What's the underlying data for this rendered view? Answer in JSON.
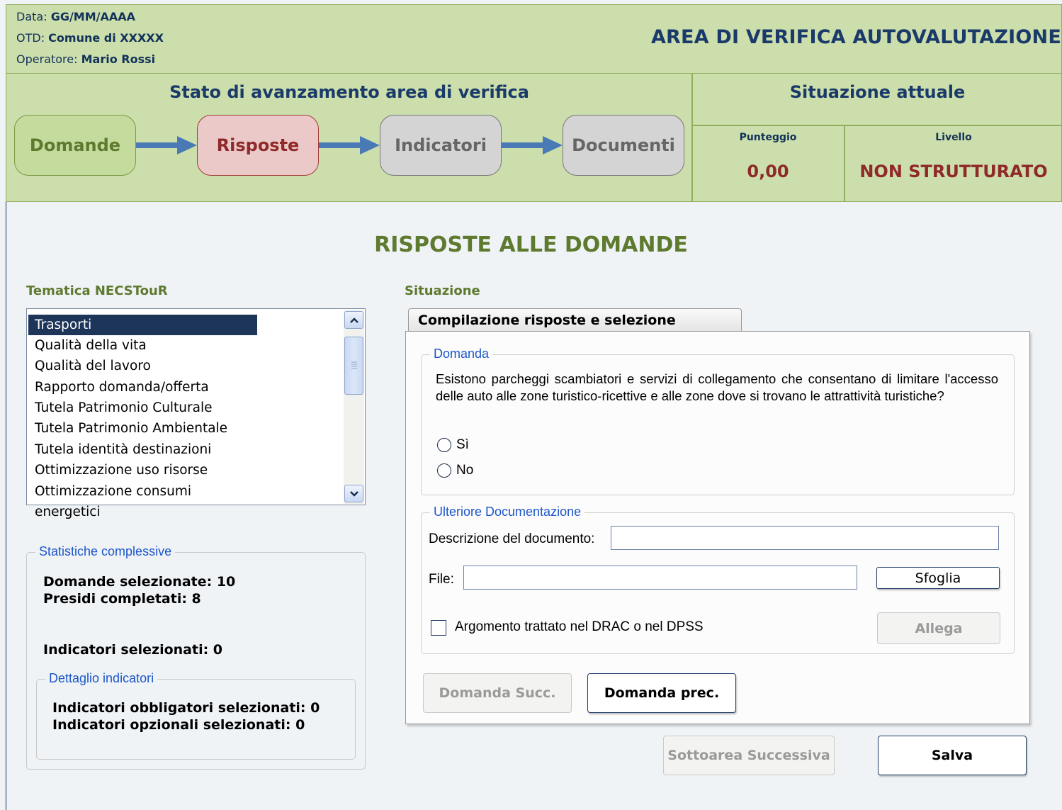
{
  "header": {
    "date_label": "Data:",
    "date_value": "GG/MM/AAAA",
    "otd_label": "OTD:",
    "otd_value": "Comune di XXXXX",
    "operator_label": "Operatore:",
    "operator_value": "Mario Rossi",
    "title": "AREA DI VERIFICA AUTOVALUTAZIONE"
  },
  "progress": {
    "title": "Stato di avanzamento area di verifica",
    "steps": [
      "Domande",
      "Risposte",
      "Indicatori",
      "Documenti"
    ],
    "current_step": "Risposte"
  },
  "situation": {
    "title": "Situazione attuale",
    "score_label": "Punteggio",
    "score_value": "0,00",
    "level_label": "Livello",
    "level_value": "NON STRUTTURATO"
  },
  "main_title": "RISPOSTE ALLE DOMANDE",
  "themes": {
    "label": "Tematica NECSTouR",
    "selected": "Trasporti",
    "items": [
      "Trasporti",
      "Qualità della vita",
      "Qualità del lavoro",
      "Rapporto domanda/offerta",
      "Tutela Patrimonio Culturale",
      "Tutela Patrimonio Ambientale",
      "Tutela identità destinazioni",
      "Ottimizzazione uso risorse",
      "Ottimizzazione consumi energetici"
    ]
  },
  "stats": {
    "legend": "Statistiche complessive",
    "domande": "Domande selezionate: 10",
    "presidi": "Presidi completati: 8",
    "indicatori": "Indicatori selezionati: 0",
    "detail_legend": "Dettaglio indicatori",
    "obbligatori": "Indicatori obbligatori selezionati: 0",
    "opzionali": "Indicatori opzionali selezionati: 0"
  },
  "situazione_label": "Situazione",
  "tab_label": "Compilazione risposte e selezione indicatori",
  "question": {
    "legend": "Domanda",
    "text": "Esistono parcheggi scambiatori e servizi di collegamento che consentano di limitare l'accesso delle auto alle zone turistico-ricettive e alle zone dove si trovano le attrattività turistiche?",
    "option_yes": "Sì",
    "option_no": "No",
    "selected": null
  },
  "documentation": {
    "legend": "Ulteriore Documentazione",
    "description_label": "Descrizione del documento:",
    "description_value": "",
    "file_label": "File:",
    "file_value": "",
    "browse_button": "Sfoglia",
    "checkbox_label": "Argomento trattato nel DRAC o nel DPSS",
    "checkbox_checked": false,
    "attach_button": "Allega"
  },
  "nav": {
    "next_question": "Domanda Succ.",
    "prev_question": "Domanda prec.",
    "next_subarea": "Sottoarea Successiva",
    "save": "Salva"
  },
  "colors": {
    "header_bg": "#ccdeab",
    "title_navy": "#1a3a6a",
    "accent_green": "#5e7a2e",
    "accent_red": "#8f2a2a",
    "legend_blue": "#1b56c9"
  }
}
